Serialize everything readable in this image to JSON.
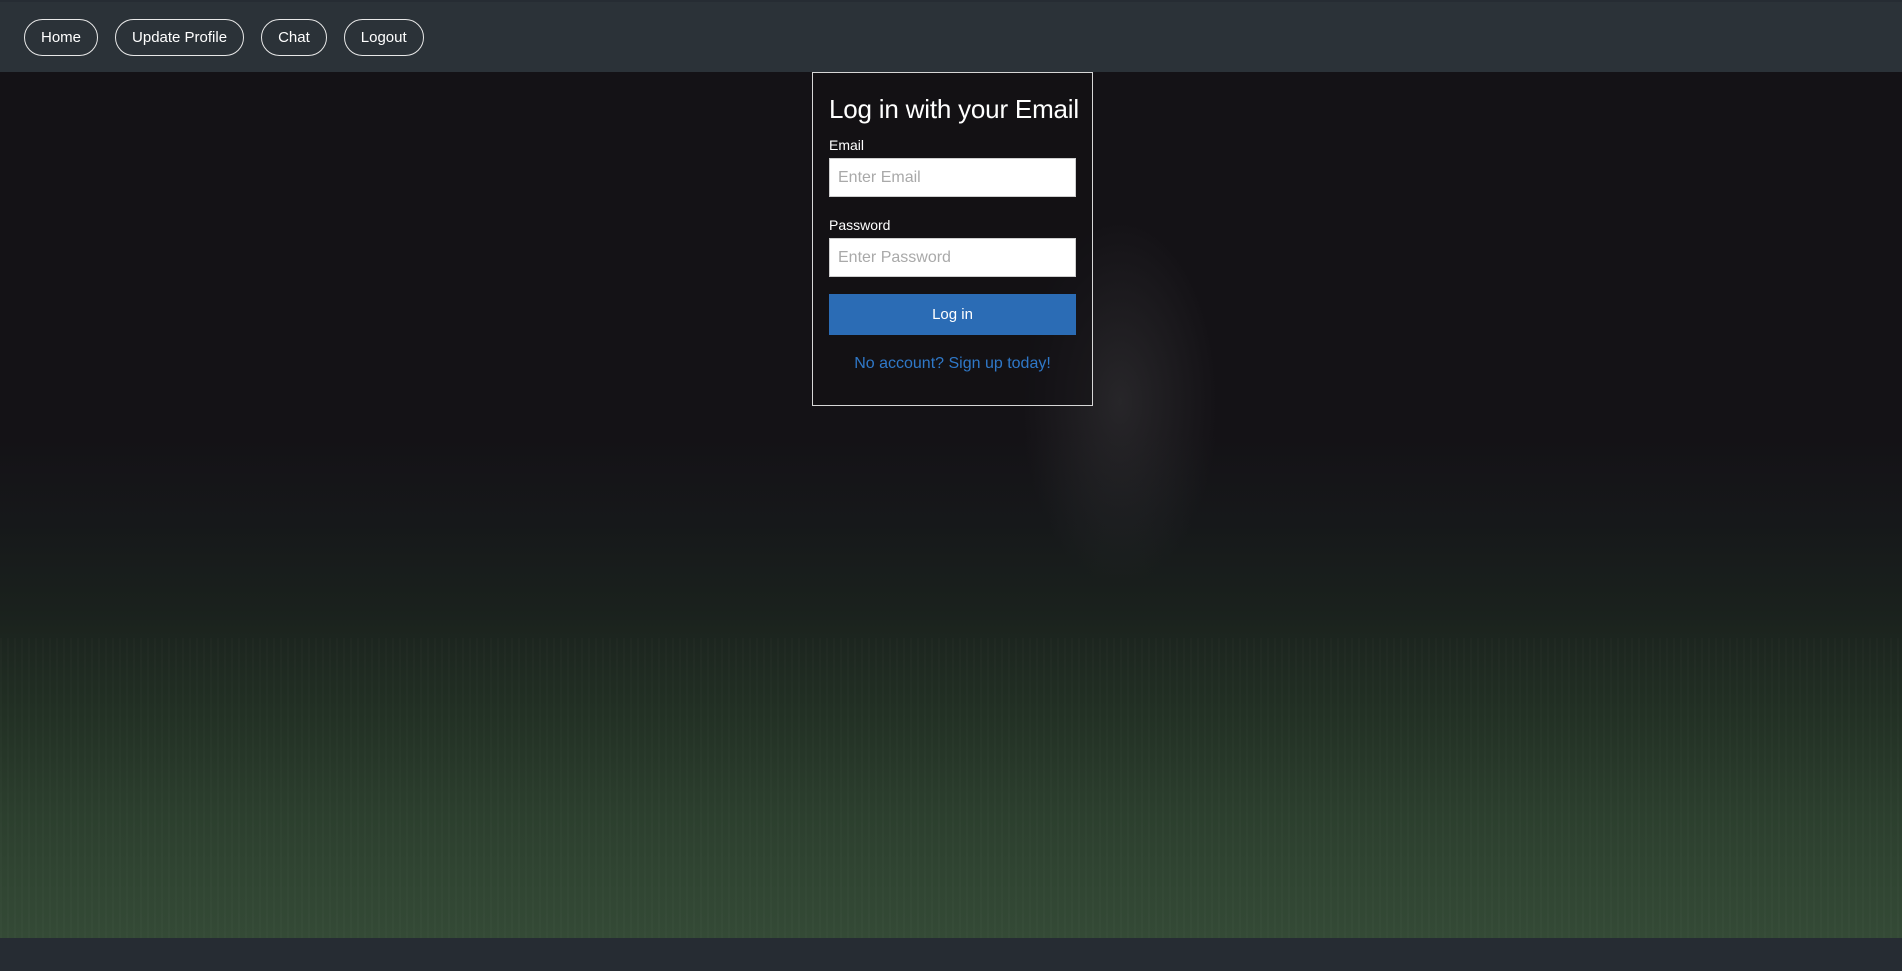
{
  "nav": {
    "items": [
      {
        "label": "Home"
      },
      {
        "label": "Update Profile"
      },
      {
        "label": "Chat"
      },
      {
        "label": "Logout"
      }
    ]
  },
  "login": {
    "title": "Log in with your Email",
    "email_label": "Email",
    "email_placeholder": "Enter Email",
    "email_value": "",
    "password_label": "Password",
    "password_placeholder": "Enter Password",
    "password_value": "",
    "submit_label": "Log in",
    "signup_text": "No account? Sign up today!"
  },
  "colors": {
    "nav_bg": "#2b3238",
    "button_primary": "#2b6cb5",
    "link": "#2f78c8"
  }
}
